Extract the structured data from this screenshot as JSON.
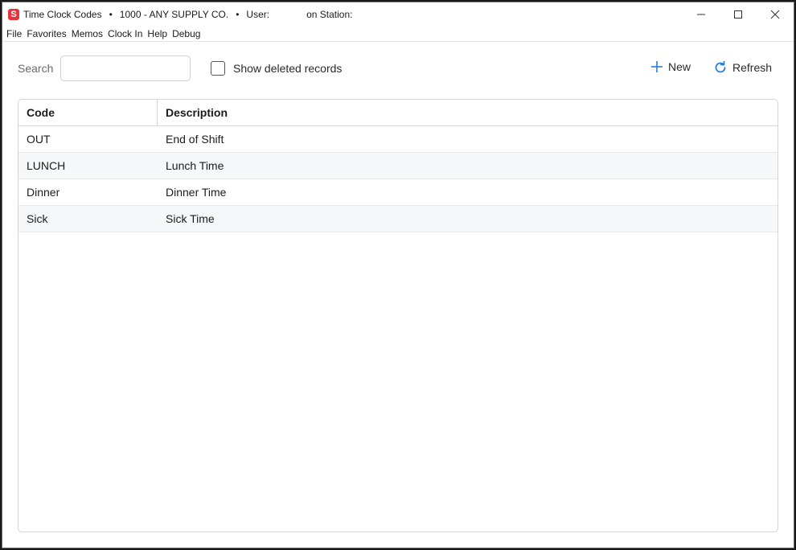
{
  "titlebar": {
    "app_icon_letter": "S",
    "window_name": "Time Clock Codes",
    "bullet": "•",
    "company": "1000 - ANY SUPPLY CO.",
    "user_label": "User:",
    "station_label": "on Station:"
  },
  "menu": [
    "File",
    "Favorites",
    "Memos",
    "Clock In",
    "Help",
    "Debug"
  ],
  "toolbar": {
    "search_label": "Search",
    "search_value": "",
    "show_deleted_label": "Show deleted records",
    "show_deleted_checked": false,
    "new_label": "New",
    "refresh_label": "Refresh"
  },
  "grid": {
    "columns": [
      "Code",
      "Description"
    ],
    "rows": [
      {
        "code": "OUT",
        "description": "End of Shift"
      },
      {
        "code": "LUNCH",
        "description": "Lunch Time"
      },
      {
        "code": "Dinner",
        "description": "Dinner Time"
      },
      {
        "code": "Sick",
        "description": "Sick Time"
      }
    ]
  },
  "colors": {
    "accent_blue": "#2b7cd3",
    "app_icon_red": "#e8313a"
  },
  "icons": {
    "app": "app-logo-icon",
    "new": "plus-icon",
    "refresh": "refresh-icon",
    "minimize": "minimize-icon",
    "maximize": "maximize-icon",
    "close": "close-icon"
  }
}
